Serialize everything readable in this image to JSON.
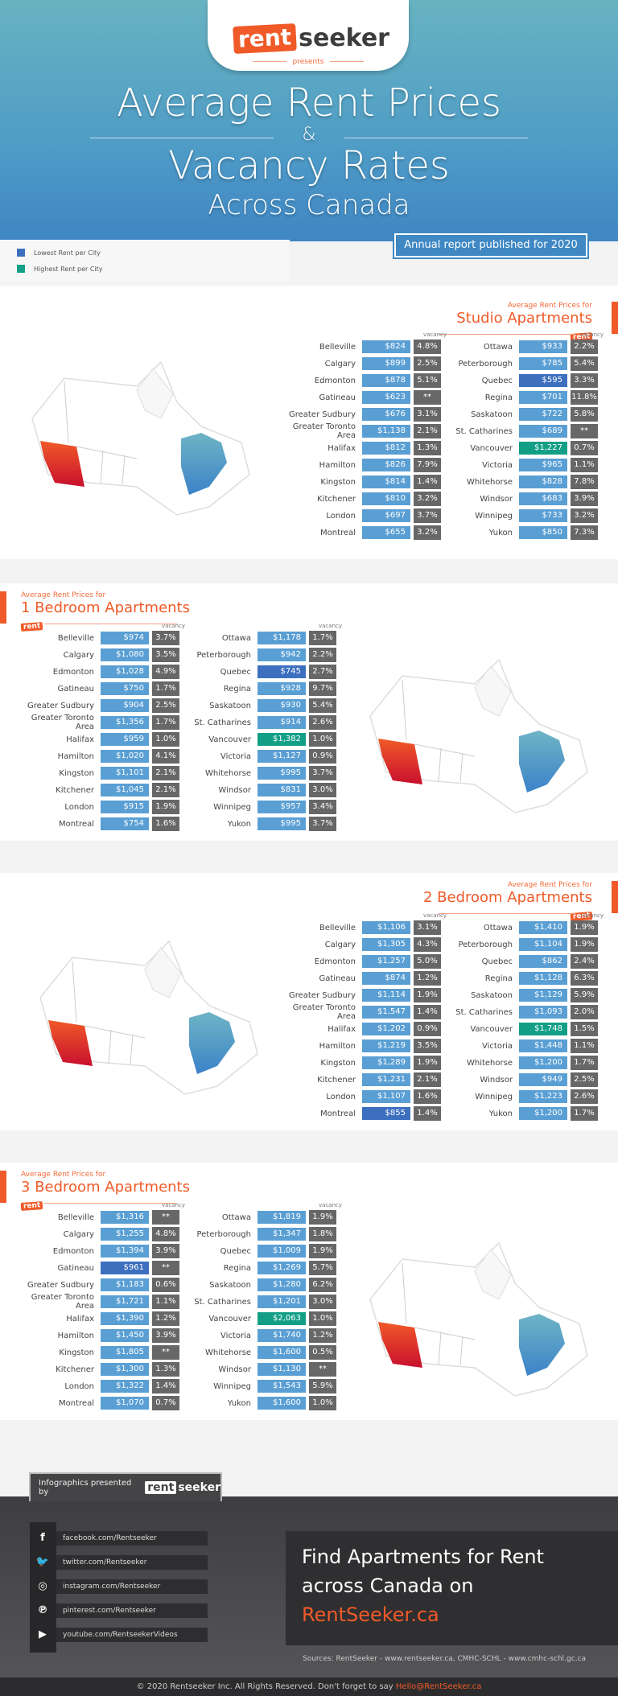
{
  "header": {
    "brand_rent": "rent",
    "brand_seeker": "seeker",
    "presents": "presents",
    "title_line1": "Average Rent Prices",
    "title_amp": "&",
    "title_line2": "Vacancy Rates",
    "title_line3": "Across Canada",
    "report_label": "Annual report published for 2020"
  },
  "legend": {
    "lowest": {
      "label": "Lowest Rent per City",
      "color": "#3d6fbf"
    },
    "highest": {
      "label": "Highest Rent per City",
      "color": "#129f86"
    }
  },
  "colors": {
    "accent": "#f05a28",
    "price": "#5a9fd4",
    "lowest": "#3d6fbf",
    "highest": "#129f86",
    "vacancy": "#676767"
  },
  "vacancy_label": "vacancy",
  "sections": [
    {
      "subtitle": "Average Rent Prices for",
      "title": "Studio Apartments",
      "tag": "rent",
      "left": [
        {
          "city": "Belleville",
          "price": "$824",
          "vacancy": "4.8%"
        },
        {
          "city": "Calgary",
          "price": "$899",
          "vacancy": "2.5%"
        },
        {
          "city": "Edmonton",
          "price": "$878",
          "vacancy": "5.1%"
        },
        {
          "city": "Gatineau",
          "price": "$623",
          "vacancy": "**"
        },
        {
          "city": "Greater Sudbury",
          "price": "$676",
          "vacancy": "3.1%"
        },
        {
          "city": "Greater Toronto Area",
          "price": "$1,138",
          "vacancy": "2.1%"
        },
        {
          "city": "Halifax",
          "price": "$812",
          "vacancy": "1.3%"
        },
        {
          "city": "Hamilton",
          "price": "$826",
          "vacancy": "7.9%"
        },
        {
          "city": "Kingston",
          "price": "$814",
          "vacancy": "1.4%"
        },
        {
          "city": "Kitchener",
          "price": "$810",
          "vacancy": "3.2%"
        },
        {
          "city": "London",
          "price": "$697",
          "vacancy": "3.7%"
        },
        {
          "city": "Montreal",
          "price": "$655",
          "vacancy": "3.2%"
        }
      ],
      "right": [
        {
          "city": "Ottawa",
          "price": "$933",
          "vacancy": "2.2%"
        },
        {
          "city": "Peterborough",
          "price": "$785",
          "vacancy": "5.4%"
        },
        {
          "city": "Quebec",
          "price": "$595",
          "vacancy": "3.3%",
          "mark": "low"
        },
        {
          "city": "Regina",
          "price": "$701",
          "vacancy": "11.8%"
        },
        {
          "city": "Saskatoon",
          "price": "$722",
          "vacancy": "5.8%"
        },
        {
          "city": "St. Catharines",
          "price": "$689",
          "vacancy": "**"
        },
        {
          "city": "Vancouver",
          "price": "$1,227",
          "vacancy": "0.7%",
          "mark": "high"
        },
        {
          "city": "Victoria",
          "price": "$965",
          "vacancy": "1.1%"
        },
        {
          "city": "Whitehorse",
          "price": "$828",
          "vacancy": "7.8%"
        },
        {
          "city": "Windsor",
          "price": "$683",
          "vacancy": "3.9%"
        },
        {
          "city": "Winnipeg",
          "price": "$733",
          "vacancy": "3.2%"
        },
        {
          "city": "Yukon",
          "price": "$850",
          "vacancy": "7.3%"
        }
      ]
    },
    {
      "subtitle": "Average Rent Prices for",
      "title": "1 Bedroom Apartments",
      "tag": "rent",
      "left": [
        {
          "city": "Belleville",
          "price": "$974",
          "vacancy": "3.7%"
        },
        {
          "city": "Calgary",
          "price": "$1,080",
          "vacancy": "3.5%"
        },
        {
          "city": "Edmonton",
          "price": "$1,028",
          "vacancy": "4.9%"
        },
        {
          "city": "Gatineau",
          "price": "$750",
          "vacancy": "1.7%"
        },
        {
          "city": "Greater Sudbury",
          "price": "$904",
          "vacancy": "2.5%"
        },
        {
          "city": "Greater Toronto Area",
          "price": "$1,356",
          "vacancy": "1.7%"
        },
        {
          "city": "Halifax",
          "price": "$959",
          "vacancy": "1.0%"
        },
        {
          "city": "Hamilton",
          "price": "$1,020",
          "vacancy": "4.1%"
        },
        {
          "city": "Kingston",
          "price": "$1,101",
          "vacancy": "2.1%"
        },
        {
          "city": "Kitchener",
          "price": "$1,045",
          "vacancy": "2.1%"
        },
        {
          "city": "London",
          "price": "$915",
          "vacancy": "1.9%"
        },
        {
          "city": "Montreal",
          "price": "$754",
          "vacancy": "1.6%"
        }
      ],
      "right": [
        {
          "city": "Ottawa",
          "price": "$1,178",
          "vacancy": "1.7%"
        },
        {
          "city": "Peterborough",
          "price": "$942",
          "vacancy": "2.2%"
        },
        {
          "city": "Quebec",
          "price": "$745",
          "vacancy": "2.7%",
          "mark": "low"
        },
        {
          "city": "Regina",
          "price": "$928",
          "vacancy": "9.7%"
        },
        {
          "city": "Saskatoon",
          "price": "$930",
          "vacancy": "5.4%"
        },
        {
          "city": "St. Catharines",
          "price": "$914",
          "vacancy": "2.6%"
        },
        {
          "city": "Vancouver",
          "price": "$1,382",
          "vacancy": "1.0%",
          "mark": "high"
        },
        {
          "city": "Victoria",
          "price": "$1,127",
          "vacancy": "0.9%"
        },
        {
          "city": "Whitehorse",
          "price": "$995",
          "vacancy": "3.7%"
        },
        {
          "city": "Windsor",
          "price": "$831",
          "vacancy": "3.0%"
        },
        {
          "city": "Winnipeg",
          "price": "$957",
          "vacancy": "3.4%"
        },
        {
          "city": "Yukon",
          "price": "$995",
          "vacancy": "3.7%"
        }
      ]
    },
    {
      "subtitle": "Average Rent Prices for",
      "title": "2 Bedroom Apartments",
      "tag": "rent",
      "left": [
        {
          "city": "Belleville",
          "price": "$1,106",
          "vacancy": "3.1%"
        },
        {
          "city": "Calgary",
          "price": "$1,305",
          "vacancy": "4.3%"
        },
        {
          "city": "Edmonton",
          "price": "$1,257",
          "vacancy": "5.0%"
        },
        {
          "city": "Gatineau",
          "price": "$874",
          "vacancy": "1.2%"
        },
        {
          "city": "Greater Sudbury",
          "price": "$1,114",
          "vacancy": "1.9%"
        },
        {
          "city": "Greater Toronto Area",
          "price": "$1,547",
          "vacancy": "1.4%"
        },
        {
          "city": "Halifax",
          "price": "$1,202",
          "vacancy": "0.9%"
        },
        {
          "city": "Hamilton",
          "price": "$1,219",
          "vacancy": "3.5%"
        },
        {
          "city": "Kingston",
          "price": "$1,289",
          "vacancy": "1.9%"
        },
        {
          "city": "Kitchener",
          "price": "$1,231",
          "vacancy": "2.1%"
        },
        {
          "city": "London",
          "price": "$1,107",
          "vacancy": "1.6%"
        },
        {
          "city": "Montreal",
          "price": "$855",
          "vacancy": "1.4%",
          "mark": "low"
        }
      ],
      "right": [
        {
          "city": "Ottawa",
          "price": "$1,410",
          "vacancy": "1.9%"
        },
        {
          "city": "Peterborough",
          "price": "$1,104",
          "vacancy": "1.9%"
        },
        {
          "city": "Quebec",
          "price": "$862",
          "vacancy": "2.4%"
        },
        {
          "city": "Regina",
          "price": "$1,128",
          "vacancy": "6.3%"
        },
        {
          "city": "Saskatoon",
          "price": "$1,129",
          "vacancy": "5.9%"
        },
        {
          "city": "St. Catharines",
          "price": "$1,093",
          "vacancy": "2.0%"
        },
        {
          "city": "Vancouver",
          "price": "$1,748",
          "vacancy": "1.5%",
          "mark": "high"
        },
        {
          "city": "Victoria",
          "price": "$1,448",
          "vacancy": "1.1%"
        },
        {
          "city": "Whitehorse",
          "price": "$1,200",
          "vacancy": "1.7%"
        },
        {
          "city": "Windsor",
          "price": "$949",
          "vacancy": "2.5%"
        },
        {
          "city": "Winnipeg",
          "price": "$1,223",
          "vacancy": "2.6%"
        },
        {
          "city": "Yukon",
          "price": "$1,200",
          "vacancy": "1.7%"
        }
      ]
    },
    {
      "subtitle": "Average Rent Prices for",
      "title": "3 Bedroom Apartments",
      "tag": "rent",
      "left": [
        {
          "city": "Belleville",
          "price": "$1,316",
          "vacancy": "**"
        },
        {
          "city": "Calgary",
          "price": "$1,255",
          "vacancy": "4.8%"
        },
        {
          "city": "Edmonton",
          "price": "$1,394",
          "vacancy": "3.9%"
        },
        {
          "city": "Gatineau",
          "price": "$961",
          "vacancy": "**",
          "mark": "low"
        },
        {
          "city": "Greater Sudbury",
          "price": "$1,183",
          "vacancy": "0.6%"
        },
        {
          "city": "Greater Toronto Area",
          "price": "$1,721",
          "vacancy": "1.1%"
        },
        {
          "city": "Halifax",
          "price": "$1,390",
          "vacancy": "1.2%"
        },
        {
          "city": "Hamilton",
          "price": "$1,450",
          "vacancy": "3.9%"
        },
        {
          "city": "Kingston",
          "price": "$1,805",
          "vacancy": "**"
        },
        {
          "city": "Kitchener",
          "price": "$1,300",
          "vacancy": "1.3%"
        },
        {
          "city": "London",
          "price": "$1,322",
          "vacancy": "1.4%"
        },
        {
          "city": "Montreal",
          "price": "$1,070",
          "vacancy": "0.7%"
        }
      ],
      "right": [
        {
          "city": "Ottawa",
          "price": "$1,819",
          "vacancy": "1.9%"
        },
        {
          "city": "Peterborough",
          "price": "$1,347",
          "vacancy": "1.8%"
        },
        {
          "city": "Quebec",
          "price": "$1,009",
          "vacancy": "1.9%"
        },
        {
          "city": "Regina",
          "price": "$1,269",
          "vacancy": "5.7%"
        },
        {
          "city": "Saskatoon",
          "price": "$1,280",
          "vacancy": "6.2%"
        },
        {
          "city": "St. Catharines",
          "price": "$1,201",
          "vacancy": "3.0%"
        },
        {
          "city": "Vancouver",
          "price": "$2,063",
          "vacancy": "1.0%",
          "mark": "high"
        },
        {
          "city": "Victoria",
          "price": "$1,740",
          "vacancy": "1.2%"
        },
        {
          "city": "Whitehorse",
          "price": "$1,600",
          "vacancy": "0.5%"
        },
        {
          "city": "Windsor",
          "price": "$1,130",
          "vacancy": "**"
        },
        {
          "city": "Winnipeg",
          "price": "$1,543",
          "vacancy": "5.9%"
        },
        {
          "city": "Yukon",
          "price": "$1,600",
          "vacancy": "1.0%"
        }
      ]
    }
  ],
  "footer": {
    "presented_by": "Infographics presented by",
    "brand_rent": "rent",
    "brand_seeker": "seeker",
    "social": [
      {
        "icon": "facebook-icon",
        "glyph": "f",
        "label": "facebook.com/Rentseeker"
      },
      {
        "icon": "twitter-icon",
        "glyph": "🐦",
        "label": "twitter.com/Rentseeker"
      },
      {
        "icon": "instagram-icon",
        "glyph": "◎",
        "label": "instagram.com/Rentseeker"
      },
      {
        "icon": "pinterest-icon",
        "glyph": "℗",
        "label": "pinterest.com/Rentseeker"
      },
      {
        "icon": "youtube-icon",
        "glyph": "▶",
        "label": "youtube.com/RentseekerVideos"
      }
    ],
    "cta_line1": "Find Apartments for Rent",
    "cta_line2": "across Canada on",
    "cta_site": "RentSeeker.ca",
    "sources": "Sources: RentSeeker - www.rentseeker.ca, CMHC-SCHL - www.cmhc-schl.gc.ca",
    "copyright": "© 2020 Rentseeker Inc. All Rights Reserved. Don't forget to say ",
    "email": "Hello@RentSeeker.ca"
  }
}
